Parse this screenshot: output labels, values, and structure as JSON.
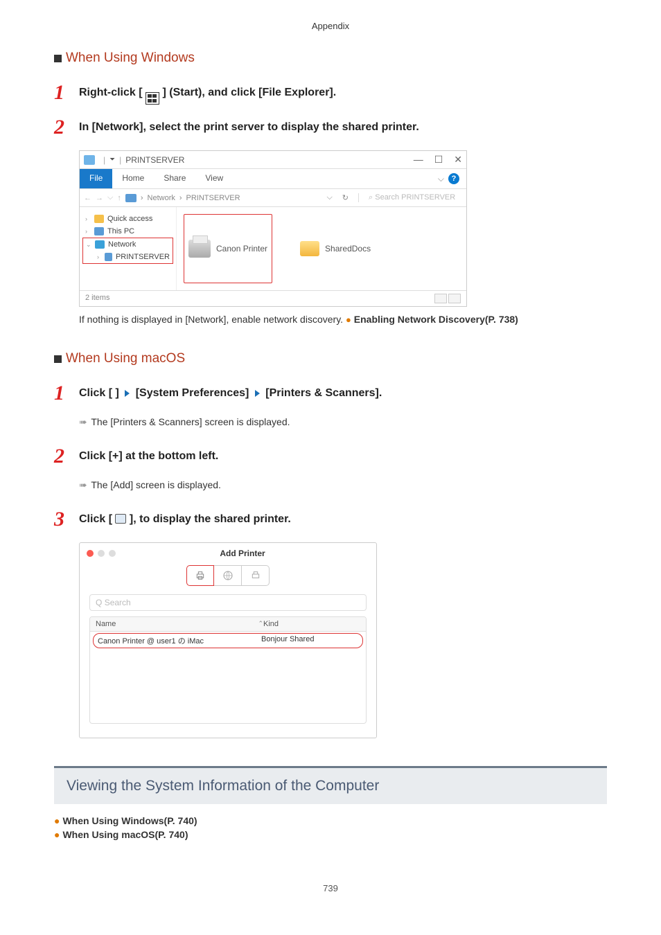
{
  "header": "Appendix",
  "page_number": "739",
  "sections": {
    "windows": {
      "heading": "When Using Windows",
      "step1": {
        "num": "1",
        "pre": "Right-click [",
        "post": "] (Start), and click [File Explorer]."
      },
      "step2": {
        "num": "2",
        "text": "In [Network], select the print server to display the shared printer."
      },
      "note_after": "If nothing is displayed in [Network], enable network discovery. ",
      "note_link": "Enabling Network Discovery(P. 738)"
    },
    "macos": {
      "heading": "When Using macOS",
      "step1": {
        "num": "1",
        "pre": "Click [ ",
        "seg1": " ] ",
        "seg2": " [System Preferences] ",
        "seg3": " [Printers & Scanners].",
        "result": "The [Printers & Scanners] screen is displayed."
      },
      "step2": {
        "num": "2",
        "text": "Click [+] at the bottom left.",
        "result": "The [Add] screen is displayed."
      },
      "step3": {
        "num": "3",
        "pre": "Click [",
        "post": "], to display the shared printer."
      }
    }
  },
  "explorer": {
    "title": "PRINTSERVER",
    "tabs": {
      "file": "File",
      "home": "Home",
      "share": "Share",
      "view": "View"
    },
    "breadcrumb": {
      "network": "Network",
      "server": "PRINTSERVER",
      "sep": "›"
    },
    "search_placeholder": "Search PRINTSERVER",
    "sidebar": {
      "quick": "Quick access",
      "thispc": "This PC",
      "network": "Network",
      "printserver": "PRINTSERVER"
    },
    "items": {
      "printer": "Canon Printer",
      "folder": "SharedDocs"
    },
    "status": "2 items"
  },
  "addprinter": {
    "title": "Add Printer",
    "search": "Search",
    "columns": {
      "name": "Name",
      "kind": "Kind"
    },
    "row": {
      "name": "Canon Printer @ user1 の iMac",
      "kind": "Bonjour Shared"
    },
    "footer": ""
  },
  "sysinfo": {
    "heading": "Viewing the System Information of the Computer",
    "links": {
      "win": "When Using Windows(P. 740)",
      "mac": "When Using macOS(P. 740)"
    }
  }
}
